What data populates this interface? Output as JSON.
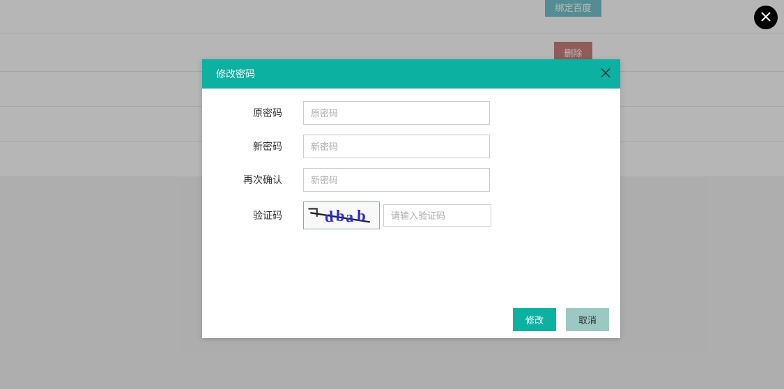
{
  "background": {
    "bind_baidu_label": "绑定百度",
    "delete_label": "删除"
  },
  "modal": {
    "title": "修改密码",
    "fields": {
      "original_password": {
        "label": "原密码",
        "placeholder": "原密码"
      },
      "new_password": {
        "label": "新密码",
        "placeholder": "新密码"
      },
      "confirm_password": {
        "label": "再次确认",
        "placeholder": "新密码"
      },
      "captcha": {
        "label": "验证码",
        "placeholder": "请输入验证码",
        "text": "dbab"
      }
    },
    "buttons": {
      "submit": "修改",
      "cancel": "取消"
    }
  }
}
